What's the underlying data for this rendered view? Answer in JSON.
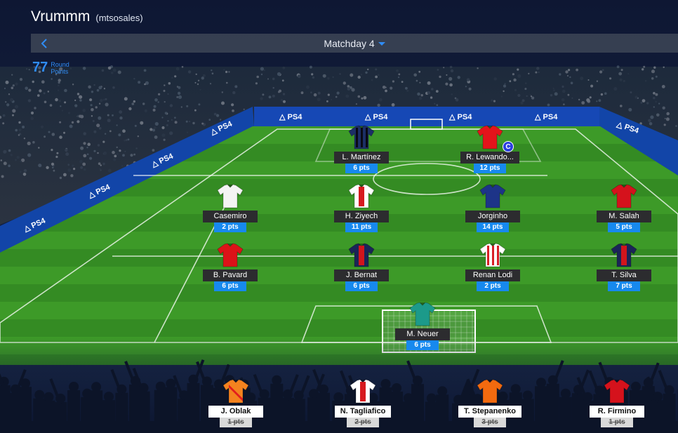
{
  "header": {
    "team_name": "Vrummm",
    "manager": "(mtsosales)"
  },
  "matchday": {
    "label": "Matchday 4"
  },
  "round_points": {
    "value": "77",
    "label_line1": "Round",
    "label_line2": "Points"
  },
  "sponsor_text": "PS4",
  "starters": [
    {
      "name": "L. Martínez",
      "points": "6 pts",
      "shirt": "#1c2f66",
      "stripe": "#0a0a14",
      "pattern": "vstripes"
    },
    {
      "name": "R. Lewando...",
      "points": "12 pts",
      "shirt": "#e3141b",
      "stripe": "#e3141b",
      "pattern": "plain",
      "captain": "C"
    },
    {
      "name": "Casemiro",
      "points": "2 pts",
      "shirt": "#f4f4f4",
      "stripe": "#f4f4f4",
      "pattern": "plain"
    },
    {
      "name": "H. Ziyech",
      "points": "11 pts",
      "shirt": "#ffffff",
      "stripe": "#d61a1f",
      "pattern": "center"
    },
    {
      "name": "Jorginho",
      "points": "14 pts",
      "shirt": "#1d3488",
      "stripe": "#1d3488",
      "pattern": "plain"
    },
    {
      "name": "M. Salah",
      "points": "5 pts",
      "shirt": "#d5121c",
      "stripe": "#d5121c",
      "pattern": "plain"
    },
    {
      "name": "B. Pavard",
      "points": "6 pts",
      "shirt": "#dc1218",
      "stripe": "#dc1218",
      "pattern": "plain"
    },
    {
      "name": "J. Bernat",
      "points": "6 pts",
      "shirt": "#1b2557",
      "stripe": "#d2151c",
      "pattern": "center"
    },
    {
      "name": "Renan Lodi",
      "points": "2 pts",
      "shirt": "#ffffff",
      "stripe": "#d81f26",
      "pattern": "vstripes"
    },
    {
      "name": "T. Silva",
      "points": "7 pts",
      "shirt": "#1b2557",
      "stripe": "#d2151c",
      "pattern": "center"
    },
    {
      "name": "M. Neuer",
      "points": "6 pts",
      "shirt": "#1c9a8a",
      "stripe": "#137566",
      "pattern": "plain"
    }
  ],
  "bench": [
    {
      "name": "J. Oblak",
      "points": "1 pts",
      "shirt": "#f4831f",
      "stripe": "#e21d1d",
      "pattern": "diag"
    },
    {
      "name": "N. Tagliafico",
      "points": "2 pts",
      "shirt": "#ffffff",
      "stripe": "#d61a1f",
      "pattern": "center"
    },
    {
      "name": "T. Stepanenko",
      "points": "3 pts",
      "shirt": "#f26a0f",
      "stripe": "#f26a0f",
      "pattern": "plain"
    },
    {
      "name": "R. Firmino",
      "points": "1 pts",
      "shirt": "#d5121c",
      "stripe": "#d5121c",
      "pattern": "plain"
    }
  ],
  "colors": {
    "accent": "#1789ee",
    "pitch_light": "#3f9e2a",
    "pitch_dark": "#2f8420",
    "board": "#1245a8"
  }
}
